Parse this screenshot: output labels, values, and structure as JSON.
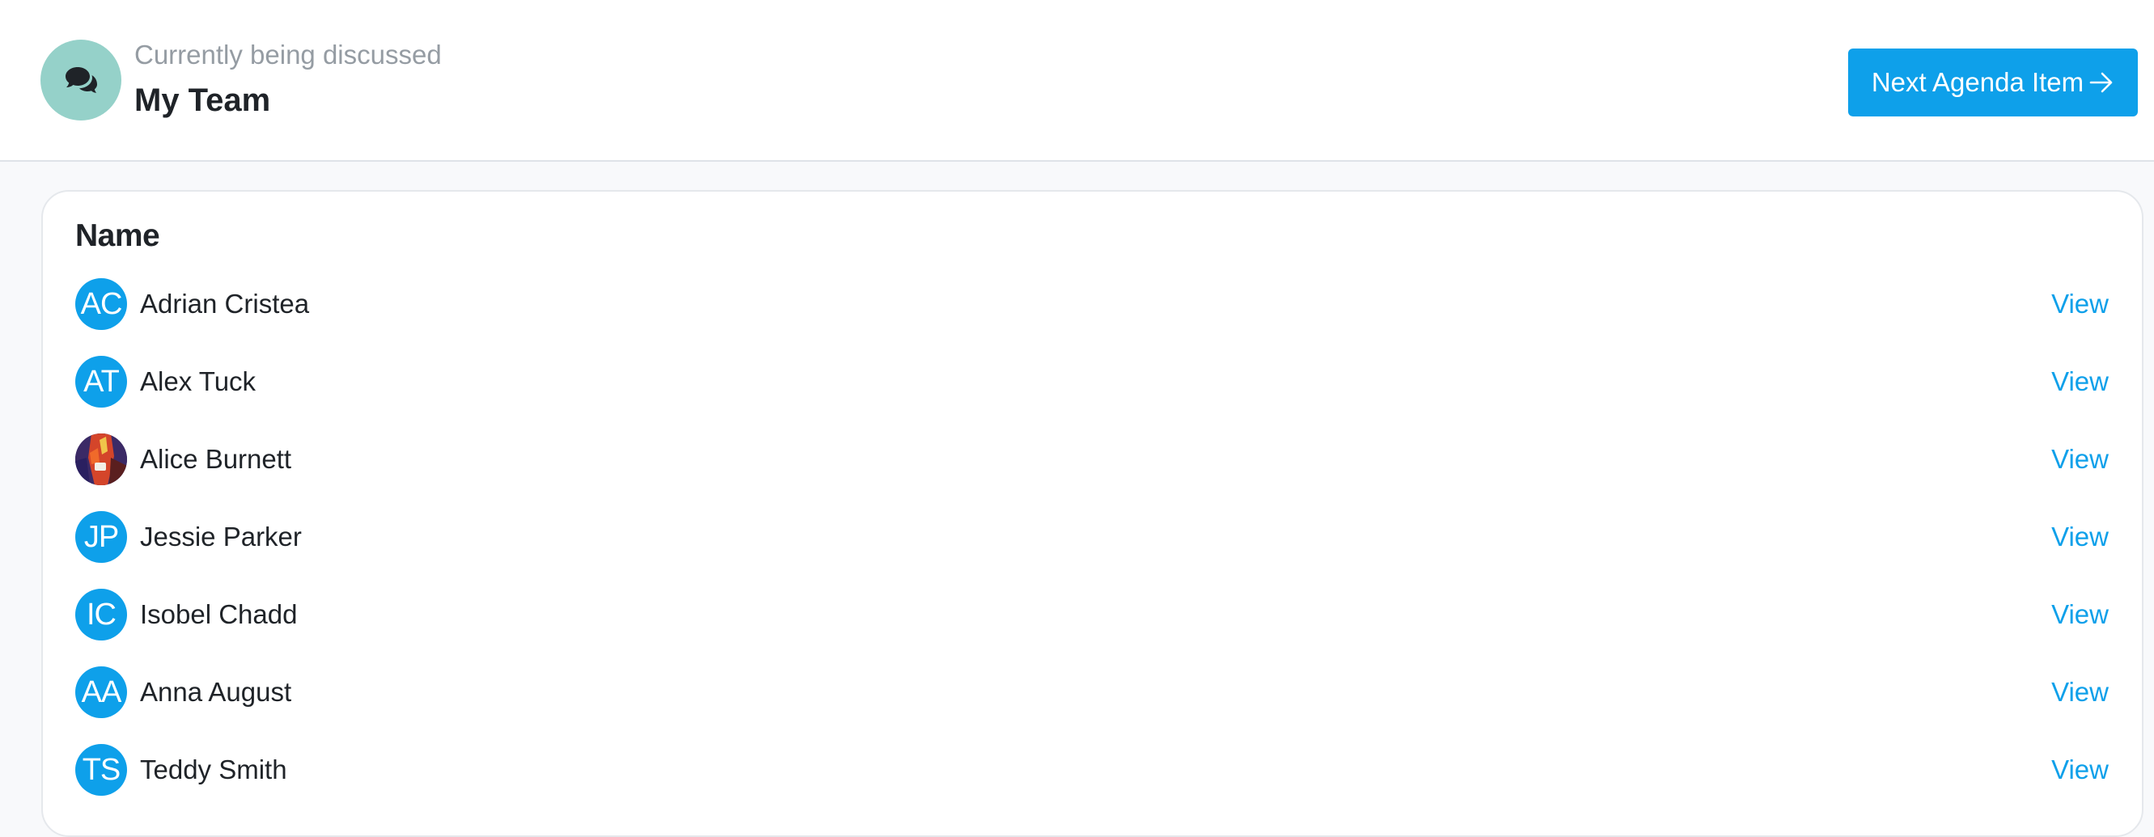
{
  "header": {
    "kicker": "Currently being discussed",
    "title": "My Team",
    "icon": "chat-bubbles-icon",
    "next_button_label": "Next Agenda Item",
    "next_button_icon": "arrow-right-icon"
  },
  "table": {
    "column_header": "Name",
    "view_label": "View",
    "members": [
      {
        "name": "Adrian Cristea",
        "initials": "AC"
      },
      {
        "name": "Alex Tuck",
        "initials": "AT"
      },
      {
        "name": "Alice Burnett",
        "initials": "",
        "avatar": "photo"
      },
      {
        "name": "Jessie Parker",
        "initials": "JP"
      },
      {
        "name": "Isobel Chadd",
        "initials": "IC"
      },
      {
        "name": "Anna August",
        "initials": "AA"
      },
      {
        "name": "Teddy Smith",
        "initials": "TS"
      }
    ]
  },
  "colors": {
    "accent": "#0ea0ea",
    "topic_icon_bg": "#95d1c9",
    "page_bg": "#f8f9fb"
  }
}
